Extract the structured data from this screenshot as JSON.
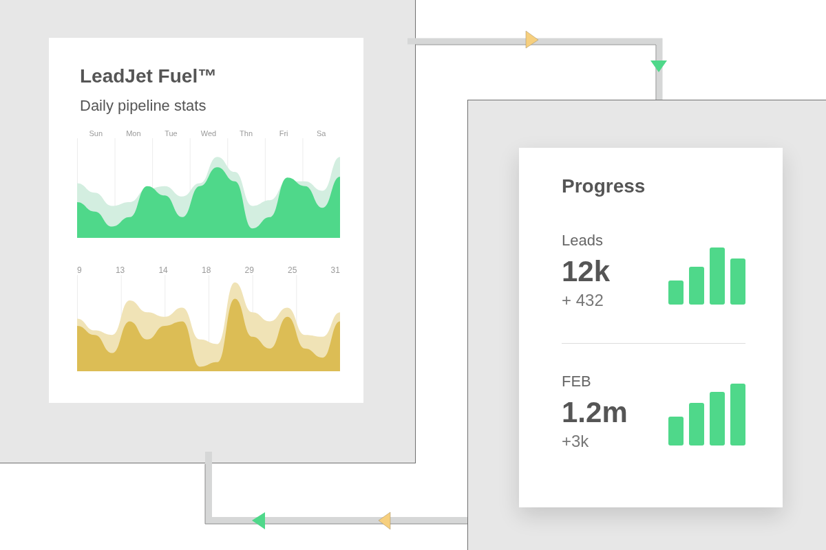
{
  "stats_card": {
    "title": "LeadJet Fuel™",
    "subtitle": "Daily pipeline stats",
    "charts": [
      {
        "labels": [
          "Sun",
          "Mon",
          "Tue",
          "Wed",
          "Thn",
          "Fri",
          "Sa"
        ]
      },
      {
        "labels": [
          "9",
          "13",
          "14",
          "18",
          "29",
          "25",
          "31"
        ]
      }
    ]
  },
  "progress_card": {
    "title": "Progress",
    "stats": [
      {
        "label": "Leads",
        "value": "12k",
        "change": "+ 432"
      },
      {
        "label": "FEB",
        "value": "1.2m",
        "change": "+3k"
      }
    ]
  }
}
